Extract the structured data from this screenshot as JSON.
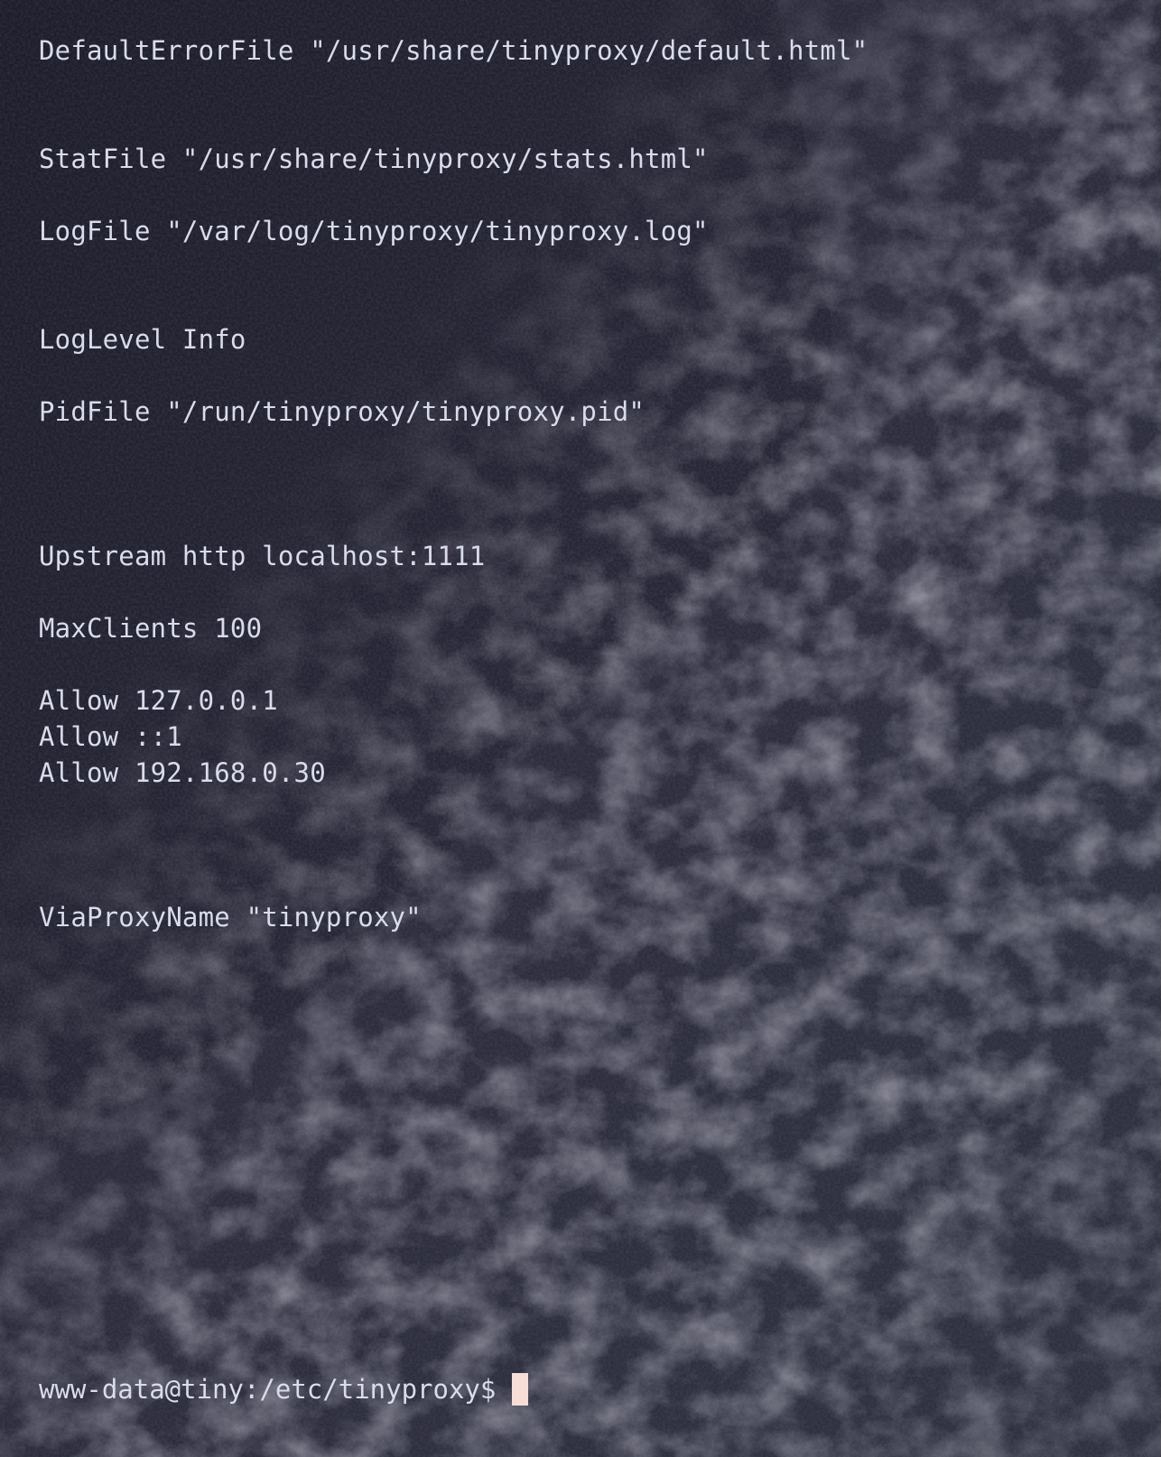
{
  "terminal": {
    "lines": {
      "default_error_file": "DefaultErrorFile \"/usr/share/tinyproxy/default.html\"",
      "stat_file": "StatFile \"/usr/share/tinyproxy/stats.html\"",
      "log_file": "LogFile \"/var/log/tinyproxy/tinyproxy.log\"",
      "log_level": "LogLevel Info",
      "pid_file": "PidFile \"/run/tinyproxy/tinyproxy.pid\"",
      "upstream": "Upstream http localhost:1111",
      "max_clients": "MaxClients 100",
      "allow_1": "Allow 127.0.0.1",
      "allow_2": "Allow ::1",
      "allow_3": "Allow 192.168.0.30",
      "via_proxy_name": "ViaProxyName \"tinyproxy\""
    },
    "prompt": "www-data@tiny:/etc/tinyproxy$"
  },
  "colors": {
    "text": "#d8dcec",
    "cursor": "#f6ddd6",
    "background": "#22222e"
  }
}
